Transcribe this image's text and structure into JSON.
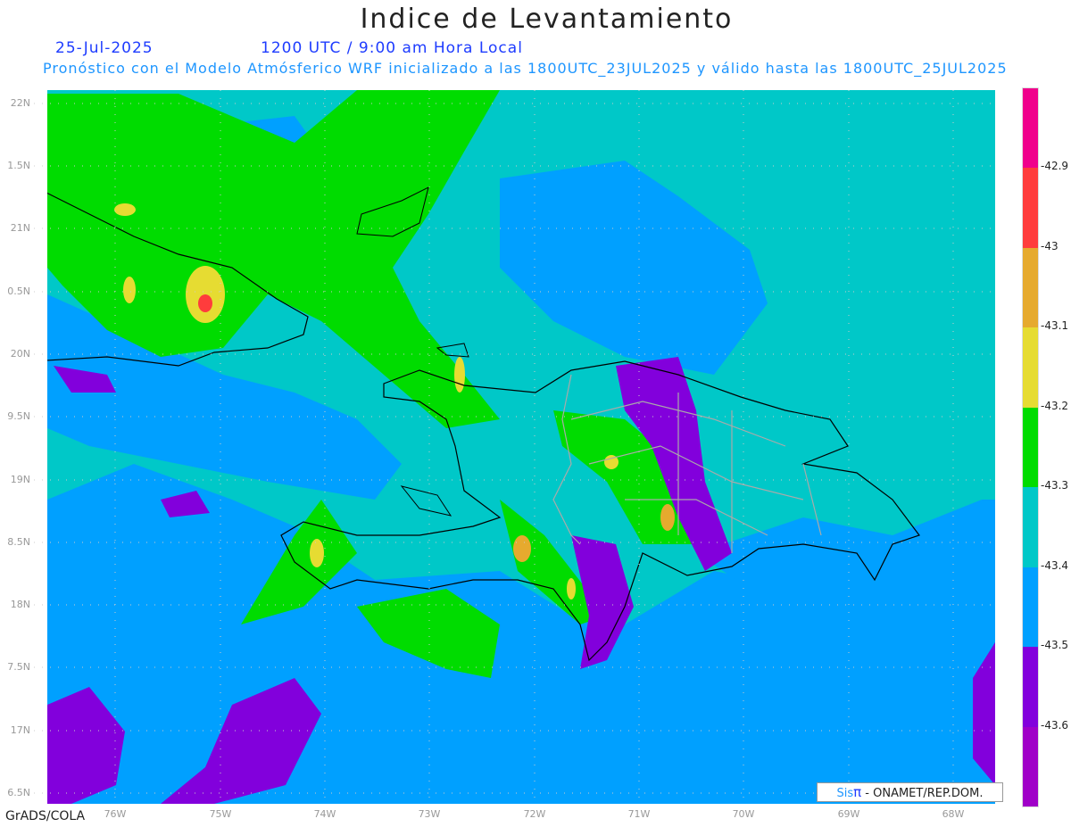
{
  "title": "Indice de Levantamiento",
  "date": "25-Jul-2025",
  "time": "1200 UTC / 9:00 am Hora Local",
  "subtitle": "Pronóstico con el Modelo Atmósferico WRF inicializado a las 1800UTC_23JUL2025 y válido hasta las  1800UTC_25JUL2025",
  "lat_labels": [
    "22N",
    "1.5N",
    "21N",
    "0.5N",
    "20N",
    "9.5N",
    "19N",
    "8.5N",
    "18N",
    "7.5N",
    "17N",
    "6.5N"
  ],
  "lon_labels": [
    "76W",
    "75W",
    "74W",
    "73W",
    "72W",
    "71W",
    "70W",
    "69W",
    "68W"
  ],
  "colorbar": {
    "colors": [
      "#f0008c",
      "#ff3c3c",
      "#e6aa2e",
      "#e6dc32",
      "#00dc00",
      "#00c8c8",
      "#00a0ff",
      "#8200dc",
      "#a000c8"
    ],
    "labels": [
      "-42.9",
      "-43",
      "-43.1",
      "-43.2",
      "-43.3",
      "-43.4",
      "-43.5",
      "-43.6"
    ]
  },
  "footer_left": "GrADS/COLA",
  "credit": {
    "sis": "Sis",
    "pi": "π",
    "rest": " - ONAMET/REP.DOM."
  }
}
